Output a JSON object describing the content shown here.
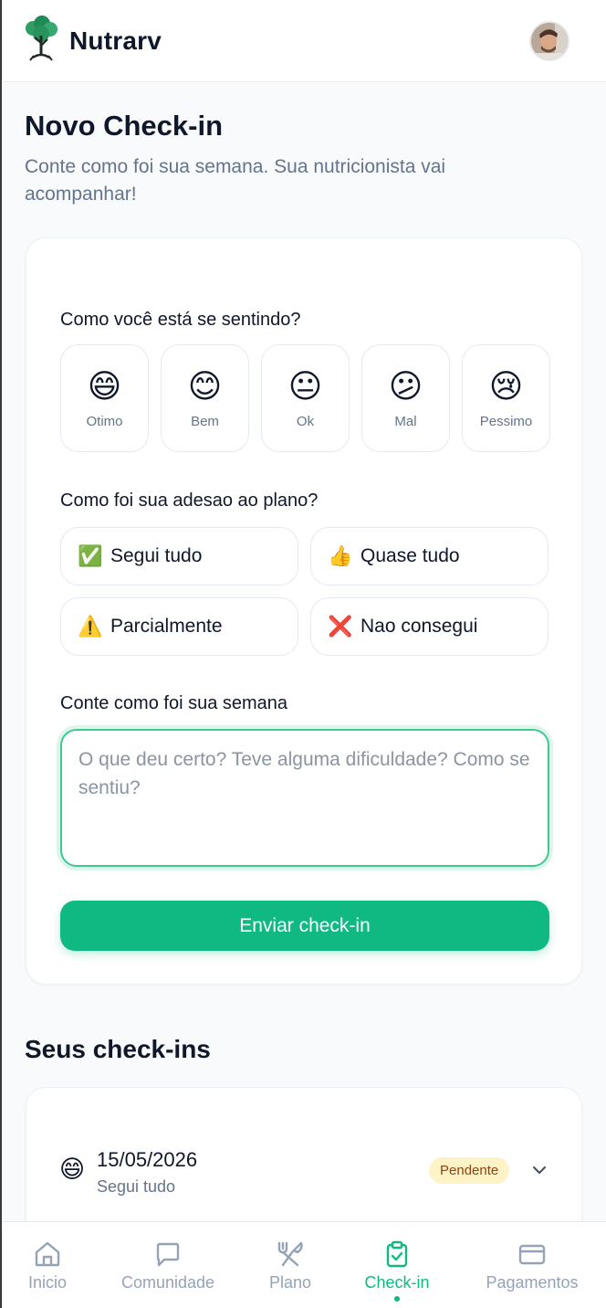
{
  "app": {
    "name": "Nutrarv"
  },
  "page": {
    "title": "Novo Check-in",
    "subtitle": "Conte como foi sua semana. Sua nutricionista vai acompanhar!"
  },
  "form": {
    "mood_question": "Como você está se sentindo?",
    "moods": [
      {
        "emoji": "😄",
        "label": "Otimo"
      },
      {
        "emoji": "😊",
        "label": "Bem"
      },
      {
        "emoji": "😐",
        "label": "Ok"
      },
      {
        "emoji": "😕",
        "label": "Mal"
      },
      {
        "emoji": "😢",
        "label": "Pessimo"
      }
    ],
    "adherence_question": "Como foi sua adesao ao plano?",
    "adherence_options": [
      {
        "emoji": "✅",
        "label": "Segui tudo"
      },
      {
        "emoji": "👍",
        "label": "Quase tudo"
      },
      {
        "emoji": "⚠️",
        "label": "Parcialmente"
      },
      {
        "emoji": "❌",
        "label": "Nao consegui"
      }
    ],
    "notes_label": "Conte como foi sua semana",
    "notes_placeholder": "O que deu certo? Teve alguma dificuldade? Como se sentiu?",
    "notes_value": "",
    "submit_label": "Enviar check-in"
  },
  "history": {
    "title": "Seus check-ins",
    "items": [
      {
        "emoji": "😄",
        "date": "15/05/2026",
        "adherence": "Segui tudo",
        "status": "Pendente"
      }
    ]
  },
  "nav": {
    "items": [
      {
        "icon": "home-icon",
        "label": "Inicio"
      },
      {
        "icon": "chat-icon",
        "label": "Comunidade"
      },
      {
        "icon": "utensils-icon",
        "label": "Plano"
      },
      {
        "icon": "clipboard-check-icon",
        "label": "Check-in"
      },
      {
        "icon": "credit-card-icon",
        "label": "Pagamentos"
      }
    ],
    "active": "Check-in"
  },
  "colors": {
    "accent": "#10b981",
    "text": "#0f172a",
    "muted": "#64748b",
    "badge_bg": "#fef3c7",
    "badge_text": "#92400e"
  }
}
